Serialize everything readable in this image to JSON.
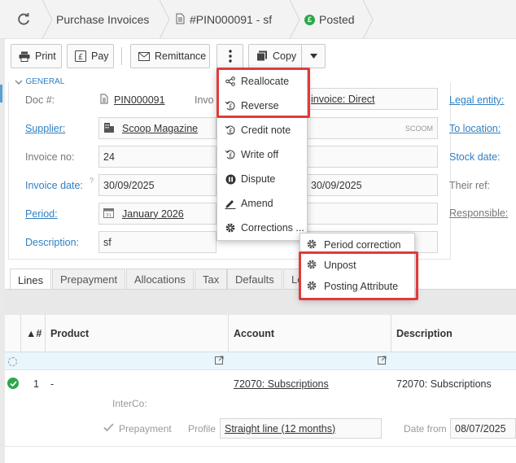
{
  "breadcrumb": {
    "module": "Purchase Invoices",
    "doc": "#PIN000091 - sf",
    "status": "Posted",
    "colors": {
      "status_dot": "#2aa84a"
    }
  },
  "toolbar": {
    "print": "Print",
    "pay": "Pay",
    "remittance": "Remittance",
    "copy": "Copy"
  },
  "menu": {
    "items": [
      "Reallocate",
      "Reverse",
      "Credit note",
      "Write off",
      "Dispute",
      "Amend",
      "Corrections ..."
    ]
  },
  "submenu": {
    "items": [
      "Period correction",
      "Unpost",
      "Posting Attribute"
    ]
  },
  "form": {
    "section": "GENERAL",
    "doc_label": "Doc #:",
    "doc_value": "PIN000091",
    "invo_trunc": "Invo",
    "invoice_type": "invoice: Direct",
    "legal_entity_label": "Legal entity:",
    "supplier_label": "Supplier:",
    "supplier_value": "Scoop Magazine",
    "supplier_code": "SCOOM",
    "to_location_label": "To location:",
    "invoice_no_label": "Invoice no:",
    "invoice_no_value": "24",
    "stock_date_label": "Stock date:",
    "invoice_date_label": "Invoice date:",
    "help_mark": "?",
    "invoice_date_value": "30/09/2025",
    "date2_value": "30/09/2025",
    "their_ref_label": "Their ref:",
    "period_label": "Period:",
    "period_value": "January 2026",
    "responsible_label": "Responsible:",
    "description_label": "Description:",
    "description_value": "sf"
  },
  "tabs": [
    "Lines",
    "Prepayment",
    "Allocations",
    "Tax",
    "Defaults",
    "Lo"
  ],
  "grid": {
    "col_num": "▲#",
    "columns": [
      "Product",
      "Account",
      "Description"
    ],
    "row": {
      "num": "1",
      "product": "-",
      "account": "72070: Subscriptions",
      "description": "72070: Subscriptions"
    },
    "interco_label": "InterCo:",
    "prepayment_label": "Prepayment",
    "profile_label": "Profile",
    "profile_value": "Straight line (12 months)",
    "date_from_label": "Date from",
    "date_from_value": "08/07/2025"
  },
  "icons": [
    "refresh-icon",
    "document-icon",
    "print-icon",
    "pound-icon",
    "envelope-icon",
    "kebab-icon",
    "copy-icon",
    "caret-down-icon",
    "calendar-icon",
    "building-icon",
    "gear-icon",
    "check-icon"
  ]
}
